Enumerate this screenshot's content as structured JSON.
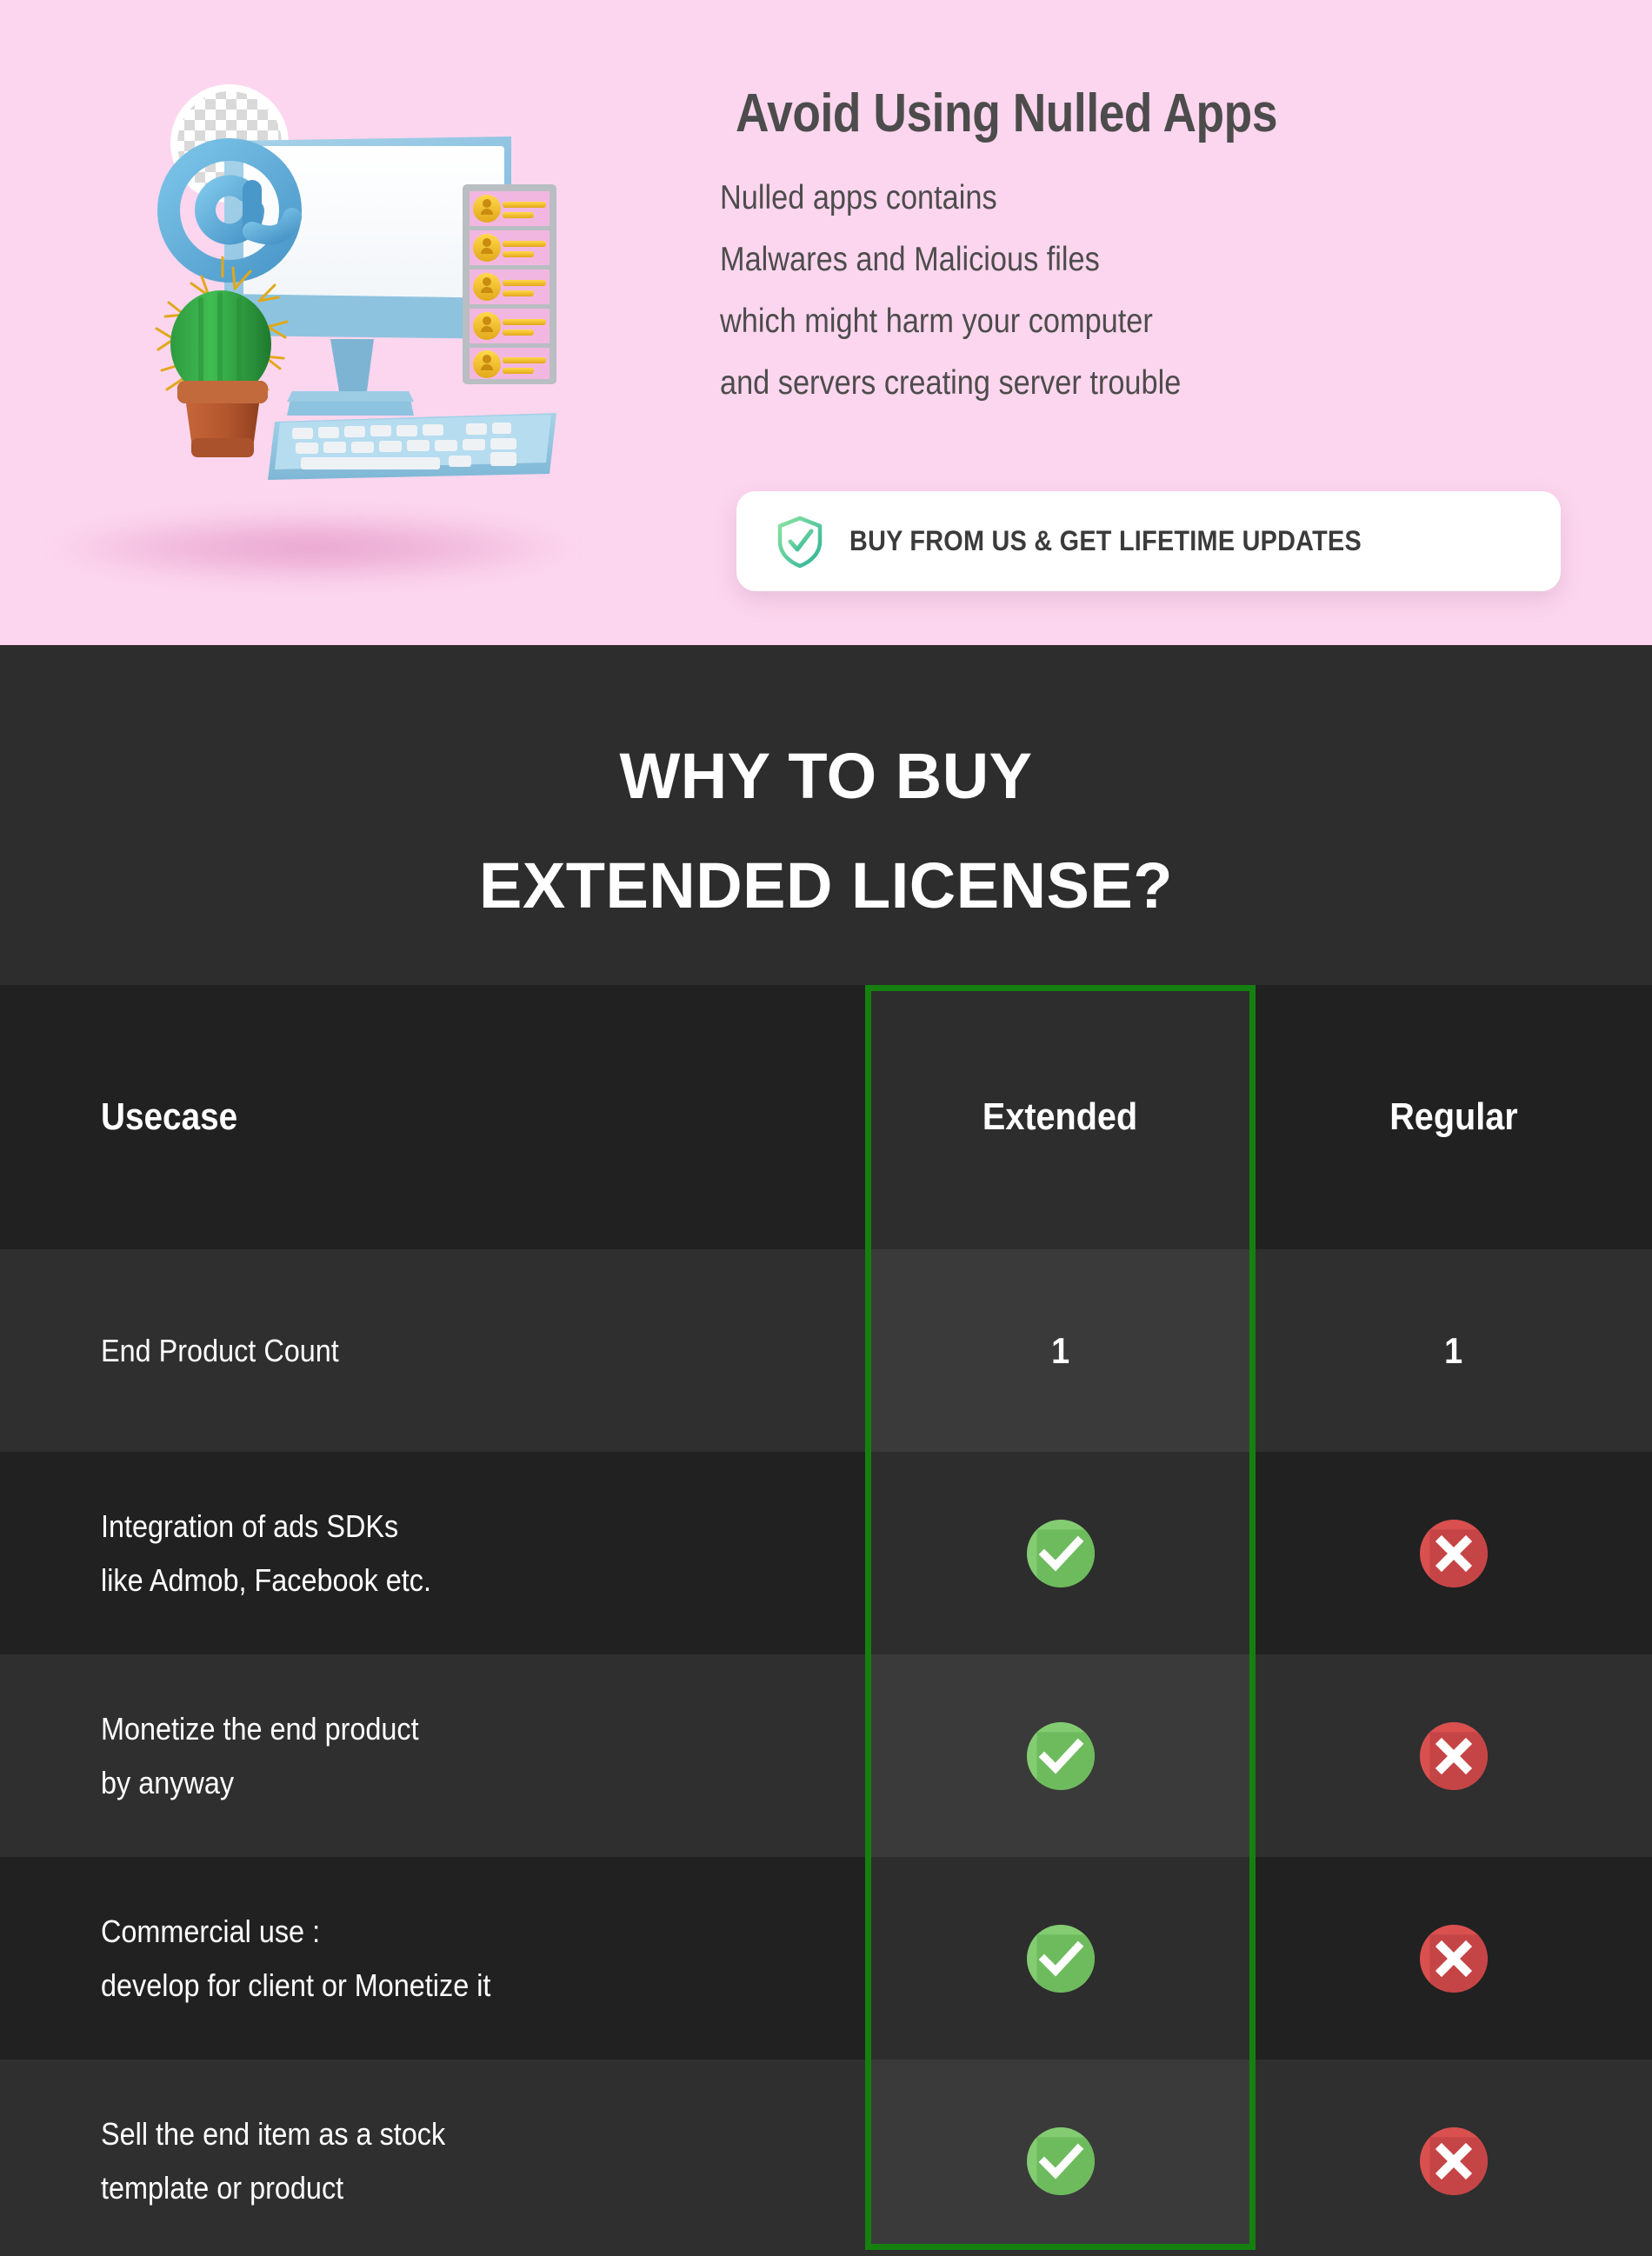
{
  "hero": {
    "title": "Avoid Using Nulled Apps",
    "lines": [
      "Nulled apps contains",
      "Malwares and Malicious files",
      "which might harm your computer",
      "and servers creating server trouble"
    ],
    "badge": {
      "icon": "shield-check-icon",
      "label": "BUY FROM US & GET LIFETIME UPDATES"
    },
    "illustration": {
      "name": "desktop-computer-3d-illustration",
      "elements": [
        "monitor",
        "keyboard",
        "cactus-in-pot",
        "at-symbol",
        "user-key-panel",
        "transparency-checker-circle"
      ]
    },
    "colors": {
      "background": "#fcd6ee",
      "text": "#4d4c4c",
      "badge_background": "#ffffff",
      "shield_gradient_start": "#86e0a4",
      "shield_gradient_end": "#2fb39a"
    }
  },
  "section": {
    "title_line_1": "WHY TO BUY",
    "title_line_2": "EXTENDED LICENSE?",
    "background": "#2e2d2d"
  },
  "table": {
    "columns": [
      "Usecase",
      "Extended",
      "Regular"
    ],
    "highlight_column": "Extended",
    "highlight_color": "#158010",
    "check_color": "#73c761",
    "cross_color": "#d64a4a",
    "rows": [
      {
        "usecase": [
          "End Product Count"
        ],
        "extended": "1",
        "regular": "1",
        "type": "text"
      },
      {
        "usecase": [
          "Integration of ads SDKs",
          "like Admob, Facebook etc."
        ],
        "extended": "check",
        "regular": "cross",
        "type": "icon"
      },
      {
        "usecase": [
          "Monetize the end product",
          "by anyway"
        ],
        "extended": "check",
        "regular": "cross",
        "type": "icon"
      },
      {
        "usecase": [
          "Commercial use :",
          "develop for client or Monetize it"
        ],
        "extended": "check",
        "regular": "cross",
        "type": "icon"
      },
      {
        "usecase": [
          "Sell the end item as a stock",
          "template or product"
        ],
        "extended": "check",
        "regular": "cross",
        "type": "icon"
      }
    ]
  }
}
